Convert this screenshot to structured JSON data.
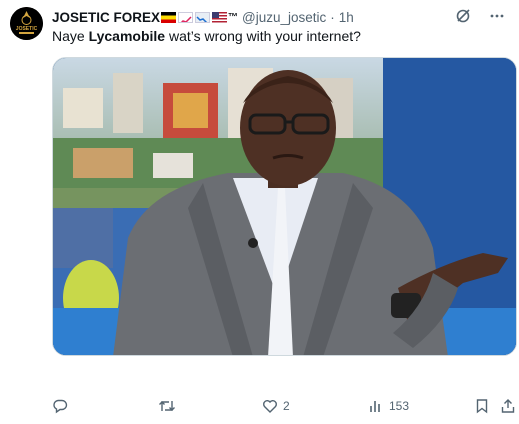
{
  "author": {
    "display_name": "JOSETIC FOREX",
    "badges": [
      "uganda-flag",
      "chart-increasing",
      "chart-decreasing",
      "us-flag"
    ],
    "tm": "™",
    "handle": "@juzu_josetic",
    "separator": "·",
    "time": "1h",
    "avatar_text": "JOSETIC"
  },
  "tweet": {
    "text_prefix": "Naye ",
    "text_bold": "Lycamobile",
    "text_suffix": " wat’s wrong with your internet?"
  },
  "media": {
    "description": "photo",
    "colors": {
      "studio_blue": "#2a63a8",
      "jacket": "#6b6e73",
      "shirt": "#e8ecf4",
      "skin": "#4a2e22"
    }
  },
  "actions": {
    "reply_count": "",
    "retweet_count": "",
    "like_count": "2",
    "views_count": "153"
  },
  "icons": [
    "grok-icon",
    "more-icon",
    "reply-icon",
    "retweet-icon",
    "like-icon",
    "views-icon",
    "bookmark-icon",
    "share-icon"
  ]
}
